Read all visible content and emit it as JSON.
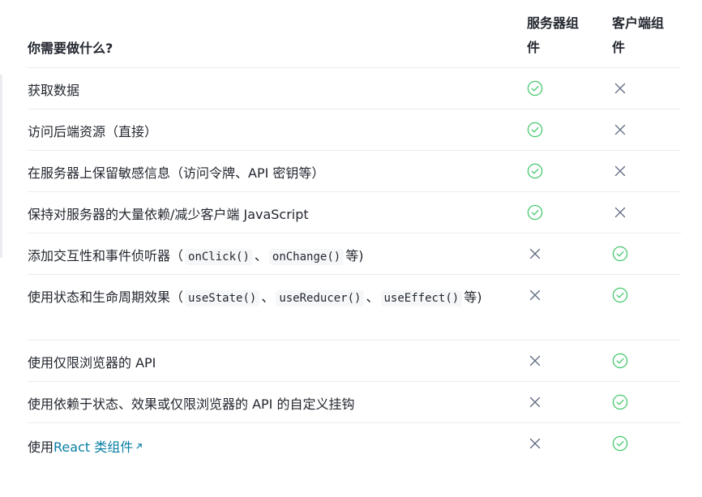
{
  "header": {
    "need": "你需要做什么?",
    "server_col": "服务器组件",
    "client_col": "客户端组件"
  },
  "rows": [
    {
      "text": "获取数据",
      "server": "yes",
      "client": "no"
    },
    {
      "text": "访问后端资源（直接）",
      "server": "yes",
      "client": "no"
    },
    {
      "text": "在服务器上保留敏感信息（访问令牌、API 密钥等）",
      "server": "yes",
      "client": "no"
    },
    {
      "text": "保持对服务器的大量依赖/减少客户端 JavaScript",
      "server": "yes",
      "client": "no"
    },
    {
      "prefix": "添加交互性和事件侦听器（",
      "code1": "onClick()",
      "sep1": "、",
      "code2": "onChange()",
      "suffix": "等)",
      "server": "no",
      "client": "yes"
    },
    {
      "prefix": "使用状态和生命周期效果（",
      "code1": "useState()",
      "sep1": "、",
      "code2": "useReducer()",
      "sep2": "、",
      "code3": "useEffect()",
      "suffix": "等)",
      "server": "no",
      "client": "yes"
    },
    {
      "text": "使用仅限浏览器的 API",
      "server": "no",
      "client": "yes"
    },
    {
      "text": "使用依赖于状态、效果或仅限浏览器的 API 的自定义挂钩",
      "server": "no",
      "client": "yes"
    },
    {
      "prefix": "使用",
      "link": "React 类组件",
      "server": "no",
      "client": "yes"
    }
  ],
  "colors": {
    "check": "#46c86e",
    "cross": "#5e687e",
    "link": "#087ea4",
    "text": "#23272f",
    "border": "#ebecf0"
  },
  "icons": {
    "yes": "check-circle-icon",
    "no": "x-icon",
    "link": "external-link-icon"
  }
}
